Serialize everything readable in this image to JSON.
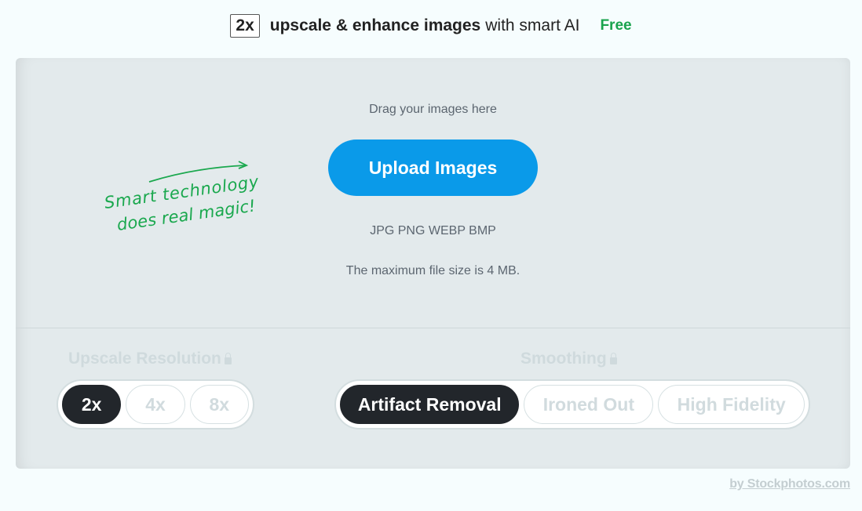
{
  "header": {
    "badge": "2x",
    "title_bold": "upscale & enhance images",
    "title_regular": "with smart AI",
    "free_label": "Free"
  },
  "upload": {
    "drag_text": "Drag your images here",
    "button_label": "Upload Images",
    "formats": "JPG PNG WEBP BMP",
    "max_size": "The maximum file size is 4 MB."
  },
  "annotation": {
    "line1": "Smart technology",
    "line2": "does real magic!"
  },
  "resolution": {
    "label": "Upscale Resolution",
    "locked": true,
    "options": [
      "2x",
      "4x",
      "8x"
    ],
    "selected": "2x"
  },
  "smoothing": {
    "label": "Smoothing",
    "locked": true,
    "options": [
      "Artifact Removal",
      "Ironed Out",
      "High Fidelity"
    ],
    "selected": "Artifact Removal"
  },
  "footer": {
    "credit": "by Stockphotos.com"
  },
  "colors": {
    "accent": "#0a9ae9",
    "free": "#19a34d",
    "selected": "#22262b",
    "annotation": "#1aa84e"
  }
}
